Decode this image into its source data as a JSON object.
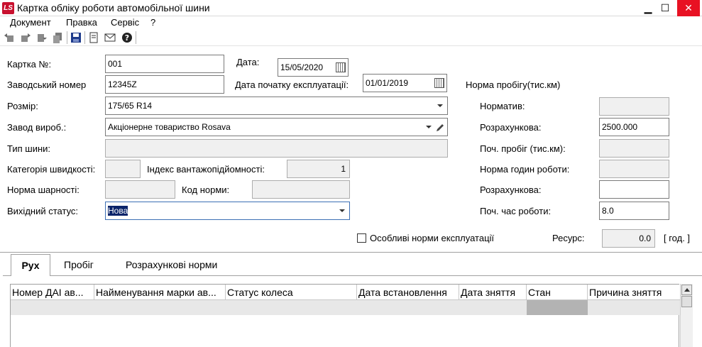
{
  "window": {
    "app_icon": "LS",
    "title": "Картка обліку роботи автомобільної шини",
    "minimize": "▁",
    "maximize": "☐",
    "close": "✕"
  },
  "menu": [
    "Документ",
    "Правка",
    "Сервіс",
    "?"
  ],
  "toolbar": {
    "icons": [
      "back-icon",
      "forward-icon",
      "next-icon",
      "copy-icon",
      "save-icon",
      "document-icon",
      "email-icon",
      "help-icon"
    ]
  },
  "form": {
    "card_no_label": "Картка №:",
    "card_no": "001",
    "date_label": "Дата:",
    "date": "15/05/2020",
    "serial_label": "Заводський номер",
    "serial": "12345Z",
    "start_date_label": "Дата початку експлуатації:",
    "start_date": "01/01/2019",
    "mileage_norm_title": "Норма пробігу(тис.км)",
    "size_label": "Розмір:",
    "size": "175/65 R14",
    "normative_label": "Норматив:",
    "normative": "",
    "manufacturer_label": "Завод вироб.:",
    "manufacturer": "Акціонерне товариство Rosava",
    "calculated_label": "Розрахункова:",
    "calculated": "2500.000",
    "tire_type_label": "Тип шини:",
    "tire_type": "",
    "start_mileage_label": "Поч. пробіг (тис.км):",
    "start_mileage": "",
    "speed_cat_label": "Категорія швидкості:",
    "speed_cat": "",
    "load_index_label": "Індекс вантажопідйомності:",
    "load_index": "1",
    "work_hours_norm_label": "Норма годин роботи:",
    "work_hours_norm": "",
    "tread_norm_label": "Норма шарності:",
    "tread_norm": "",
    "norm_code_label": "Код норми:",
    "norm_code": "",
    "calculated2_label": "Розрахункова:",
    "calculated2": "",
    "status_label": "Вихідний статус:",
    "status": "Нова",
    "start_hours_label": "Поч. час роботи:",
    "start_hours": "8.0",
    "special_norms_label": "Особливі норми експлуатації",
    "special_norms_checked": false,
    "resource_label": "Ресурс:",
    "resource": "0.0",
    "resource_unit": "[ год. ]"
  },
  "tabs": [
    "Рух",
    "Пробіг",
    "Розрахункові норми"
  ],
  "active_tab": "Рух",
  "grid": {
    "columns": [
      "Номер ДАІ ав...",
      "Найменування марки ав...",
      "Статус колеса",
      "Дата встановлення",
      "Дата зняття",
      "Стан",
      "Причина зняття"
    ]
  }
}
